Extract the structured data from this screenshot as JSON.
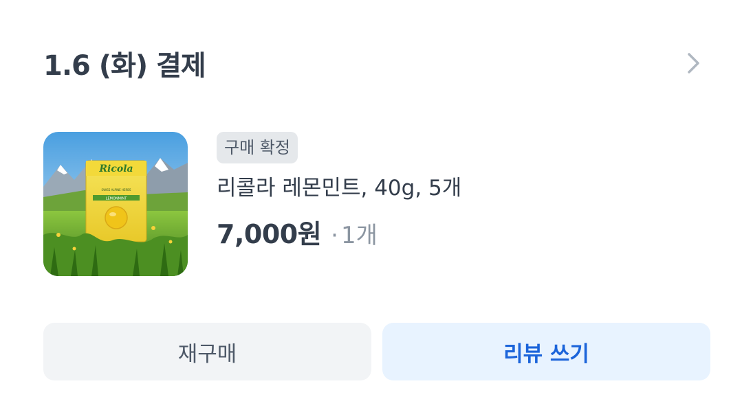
{
  "order": {
    "title": "1.6 (화) 결제"
  },
  "product": {
    "status_badge": "구매 확정",
    "name": "리콜라 레몬민트, 40g, 5개",
    "price": "7,000원",
    "quantity_separator": "·",
    "quantity": "1개",
    "image": {
      "brand": "Ricola",
      "banner_text": "SWISS ALPINE HERBS",
      "flavor": "LEMONMINT"
    }
  },
  "actions": {
    "rebuy_label": "재구매",
    "review_label": "리뷰 쓰기"
  },
  "colors": {
    "title_text": "#333d4b",
    "badge_bg": "#e5e8eb",
    "secondary_text": "#8b95a1",
    "rebuy_bg": "#f2f4f6",
    "review_bg": "#e8f3ff",
    "review_text": "#1b64da"
  }
}
